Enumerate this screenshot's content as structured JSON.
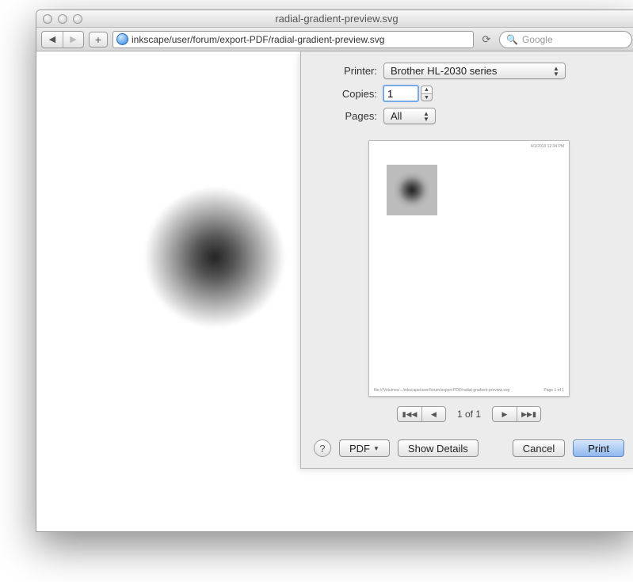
{
  "window": {
    "title": "radial-gradient-preview.svg"
  },
  "toolbar": {
    "address": "inkscape/user/forum/export-PDF/radial-gradient-preview.svg",
    "search_placeholder": "Google",
    "plus": "+"
  },
  "print": {
    "labels": {
      "printer": "Printer:",
      "copies": "Copies:",
      "pages": "Pages:"
    },
    "printer_value": "Brother HL-2030 series",
    "copies_value": "1",
    "pages_value": "All",
    "page_indicator": "1 of 1",
    "buttons": {
      "help": "?",
      "pdf": "PDF",
      "show_details": "Show Details",
      "cancel": "Cancel",
      "print": "Print"
    },
    "preview": {
      "header_right": "4/1/2013 12:34 PM",
      "footer_left": "file:///Volumes/.../inkscape/user/forum/export-PDF/radial-gradient-preview.svg",
      "footer_right": "Page 1 of 1"
    }
  }
}
